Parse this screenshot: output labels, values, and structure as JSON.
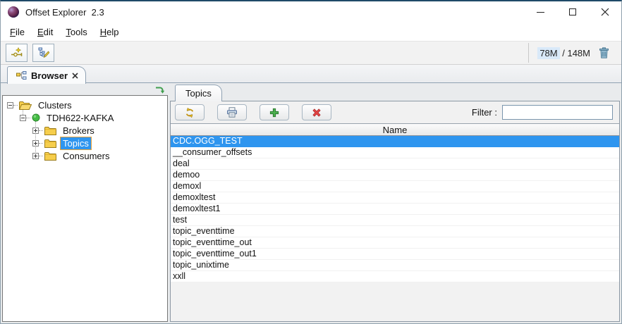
{
  "window": {
    "title": "Offset Explorer  2.3"
  },
  "menu": {
    "items": [
      "File",
      "Edit",
      "Tools",
      "Help"
    ]
  },
  "toolbar": {
    "memory_used": "78M",
    "memory_separator": " / ",
    "memory_total": "148M"
  },
  "tabs": {
    "browser": "Browser"
  },
  "tree": {
    "items": [
      {
        "label": "Clusters",
        "level": 0,
        "expanded": true,
        "icon": "folder-open"
      },
      {
        "label": "TDH622-KAFKA",
        "level": 1,
        "expanded": true,
        "icon": "green-status-dot"
      },
      {
        "label": "Brokers",
        "level": 2,
        "expanded": false,
        "icon": "folder"
      },
      {
        "label": "Topics",
        "level": 2,
        "expanded": false,
        "icon": "folder",
        "selected": true
      },
      {
        "label": "Consumers",
        "level": 2,
        "expanded": false,
        "icon": "folder"
      }
    ]
  },
  "panel": {
    "tab": "Topics",
    "filter_label": "Filter :",
    "filter_value": ""
  },
  "table": {
    "header": "Name",
    "selected_row": "CDC.OGG_TEST",
    "rows": [
      "CDC.OGG_TEST",
      "__consumer_offsets",
      "deal",
      "demoo",
      "demoxl",
      "demoxltest",
      "demoxltest1",
      "test",
      "topic_eventtime",
      "topic_eventtime_out",
      "topic_eventtime_out1",
      "topic_unixtime",
      "xxll"
    ]
  },
  "colors": {
    "selection": "#2E95EF",
    "tree_selection_border": "#E8A33D",
    "memory_highlight": "#D9E9F9",
    "status_green": "#44BB44",
    "folder_gold": "#F6CE4C",
    "add_green": "#4CB04F",
    "delete_red": "#E04343",
    "refresh_gold": "#C49410"
  }
}
